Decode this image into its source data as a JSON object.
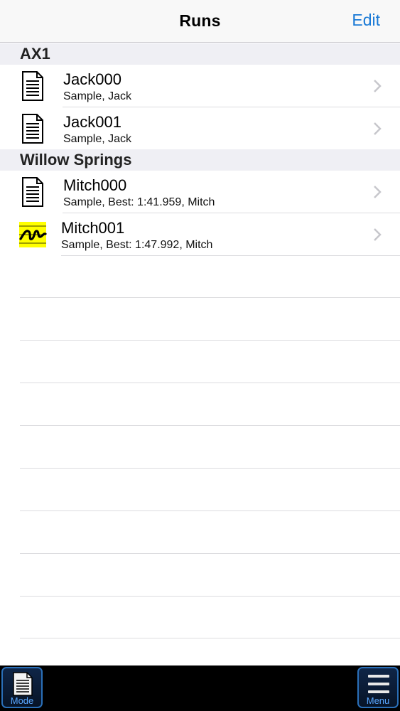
{
  "navbar": {
    "title": "Runs",
    "edit_label": "Edit"
  },
  "sections": [
    {
      "header": "AX1",
      "rows": [
        {
          "title": "Jack000",
          "subtitle": "Sample, Jack",
          "icon": "document-icon"
        },
        {
          "title": "Jack001",
          "subtitle": "Sample, Jack",
          "icon": "document-icon"
        }
      ]
    },
    {
      "header": "Willow Springs",
      "rows": [
        {
          "title": "Mitch000",
          "subtitle": "Sample, Best: 1:41.959, Mitch",
          "icon": "document-icon"
        },
        {
          "title": "Mitch001",
          "subtitle": "Sample, Best: 1:47.992, Mitch",
          "icon": "graph-icon"
        }
      ]
    }
  ],
  "toolbar": {
    "mode_label": "Mode",
    "menu_label": "Menu"
  },
  "colors": {
    "accent": "#1a7ad6",
    "section_bg": "#efeff4",
    "toolbar_bg": "#000000",
    "toolbar_label": "#5aa7ff",
    "graph_icon_bg": "#ffff00"
  }
}
